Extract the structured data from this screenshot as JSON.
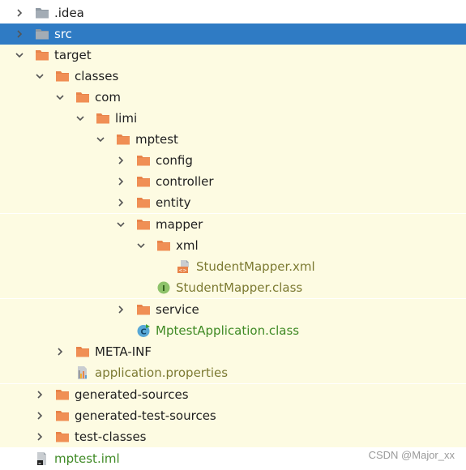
{
  "tree": {
    "rows": [
      {
        "label": ".idea",
        "chevron": "right",
        "icon": "folder-gray-icon",
        "style": "white"
      },
      {
        "label": "src",
        "chevron": "right",
        "icon": "folder-gray-icon",
        "style": "selected"
      },
      {
        "label": "target",
        "chevron": "down",
        "icon": "folder-orange-icon",
        "style": "excluded"
      },
      {
        "label": "classes",
        "chevron": "down",
        "icon": "folder-orange-icon",
        "style": "excluded"
      },
      {
        "label": "com",
        "chevron": "down",
        "icon": "folder-orange-icon",
        "style": "excluded"
      },
      {
        "label": "limi",
        "chevron": "down",
        "icon": "folder-orange-icon",
        "style": "excluded"
      },
      {
        "label": "mptest",
        "chevron": "down",
        "icon": "folder-orange-icon",
        "style": "excluded"
      },
      {
        "label": "config",
        "chevron": "right",
        "icon": "folder-orange-icon",
        "style": "excluded"
      },
      {
        "label": "controller",
        "chevron": "right",
        "icon": "folder-orange-icon",
        "style": "excluded"
      },
      {
        "label": "entity",
        "chevron": "right",
        "icon": "folder-orange-icon",
        "style": "excluded"
      },
      {
        "label": "mapper",
        "chevron": "down",
        "icon": "folder-orange-icon",
        "style": "excluded"
      },
      {
        "label": "xml",
        "chevron": "down",
        "icon": "folder-orange-icon",
        "style": "excluded"
      },
      {
        "label": "StudentMapper.xml",
        "chevron": "none",
        "icon": "xml-file-icon",
        "style": "excluded"
      },
      {
        "label": "StudentMapper.class",
        "chevron": "none",
        "icon": "interface-class-icon",
        "style": "excluded"
      },
      {
        "label": "service",
        "chevron": "right",
        "icon": "folder-orange-icon",
        "style": "excluded"
      },
      {
        "label": "MptestApplication.class",
        "chevron": "none",
        "icon": "class-file-icon",
        "style": "excluded"
      },
      {
        "label": "META-INF",
        "chevron": "right",
        "icon": "folder-orange-icon",
        "style": "excluded"
      },
      {
        "label": "application.properties",
        "chevron": "none",
        "icon": "properties-file-icon",
        "style": "excluded"
      },
      {
        "label": "generated-sources",
        "chevron": "right",
        "icon": "folder-orange-icon",
        "style": "excluded"
      },
      {
        "label": "generated-test-sources",
        "chevron": "right",
        "icon": "folder-orange-icon",
        "style": "excluded"
      },
      {
        "label": "test-classes",
        "chevron": "right",
        "icon": "folder-orange-icon",
        "style": "excluded"
      },
      {
        "label": "mptest.iml",
        "chevron": "none",
        "icon": "iml-file-icon",
        "style": "white"
      }
    ]
  },
  "watermark": "CSDN @Major_xx",
  "colors": {
    "selection": "#2f7bc4",
    "excluded_background": "#fdfbe2",
    "folder_orange": "#e8844a",
    "folder_gray": "#9aa4ad",
    "green_text": "#3f8a25",
    "olive_text": "#7c7a32"
  }
}
